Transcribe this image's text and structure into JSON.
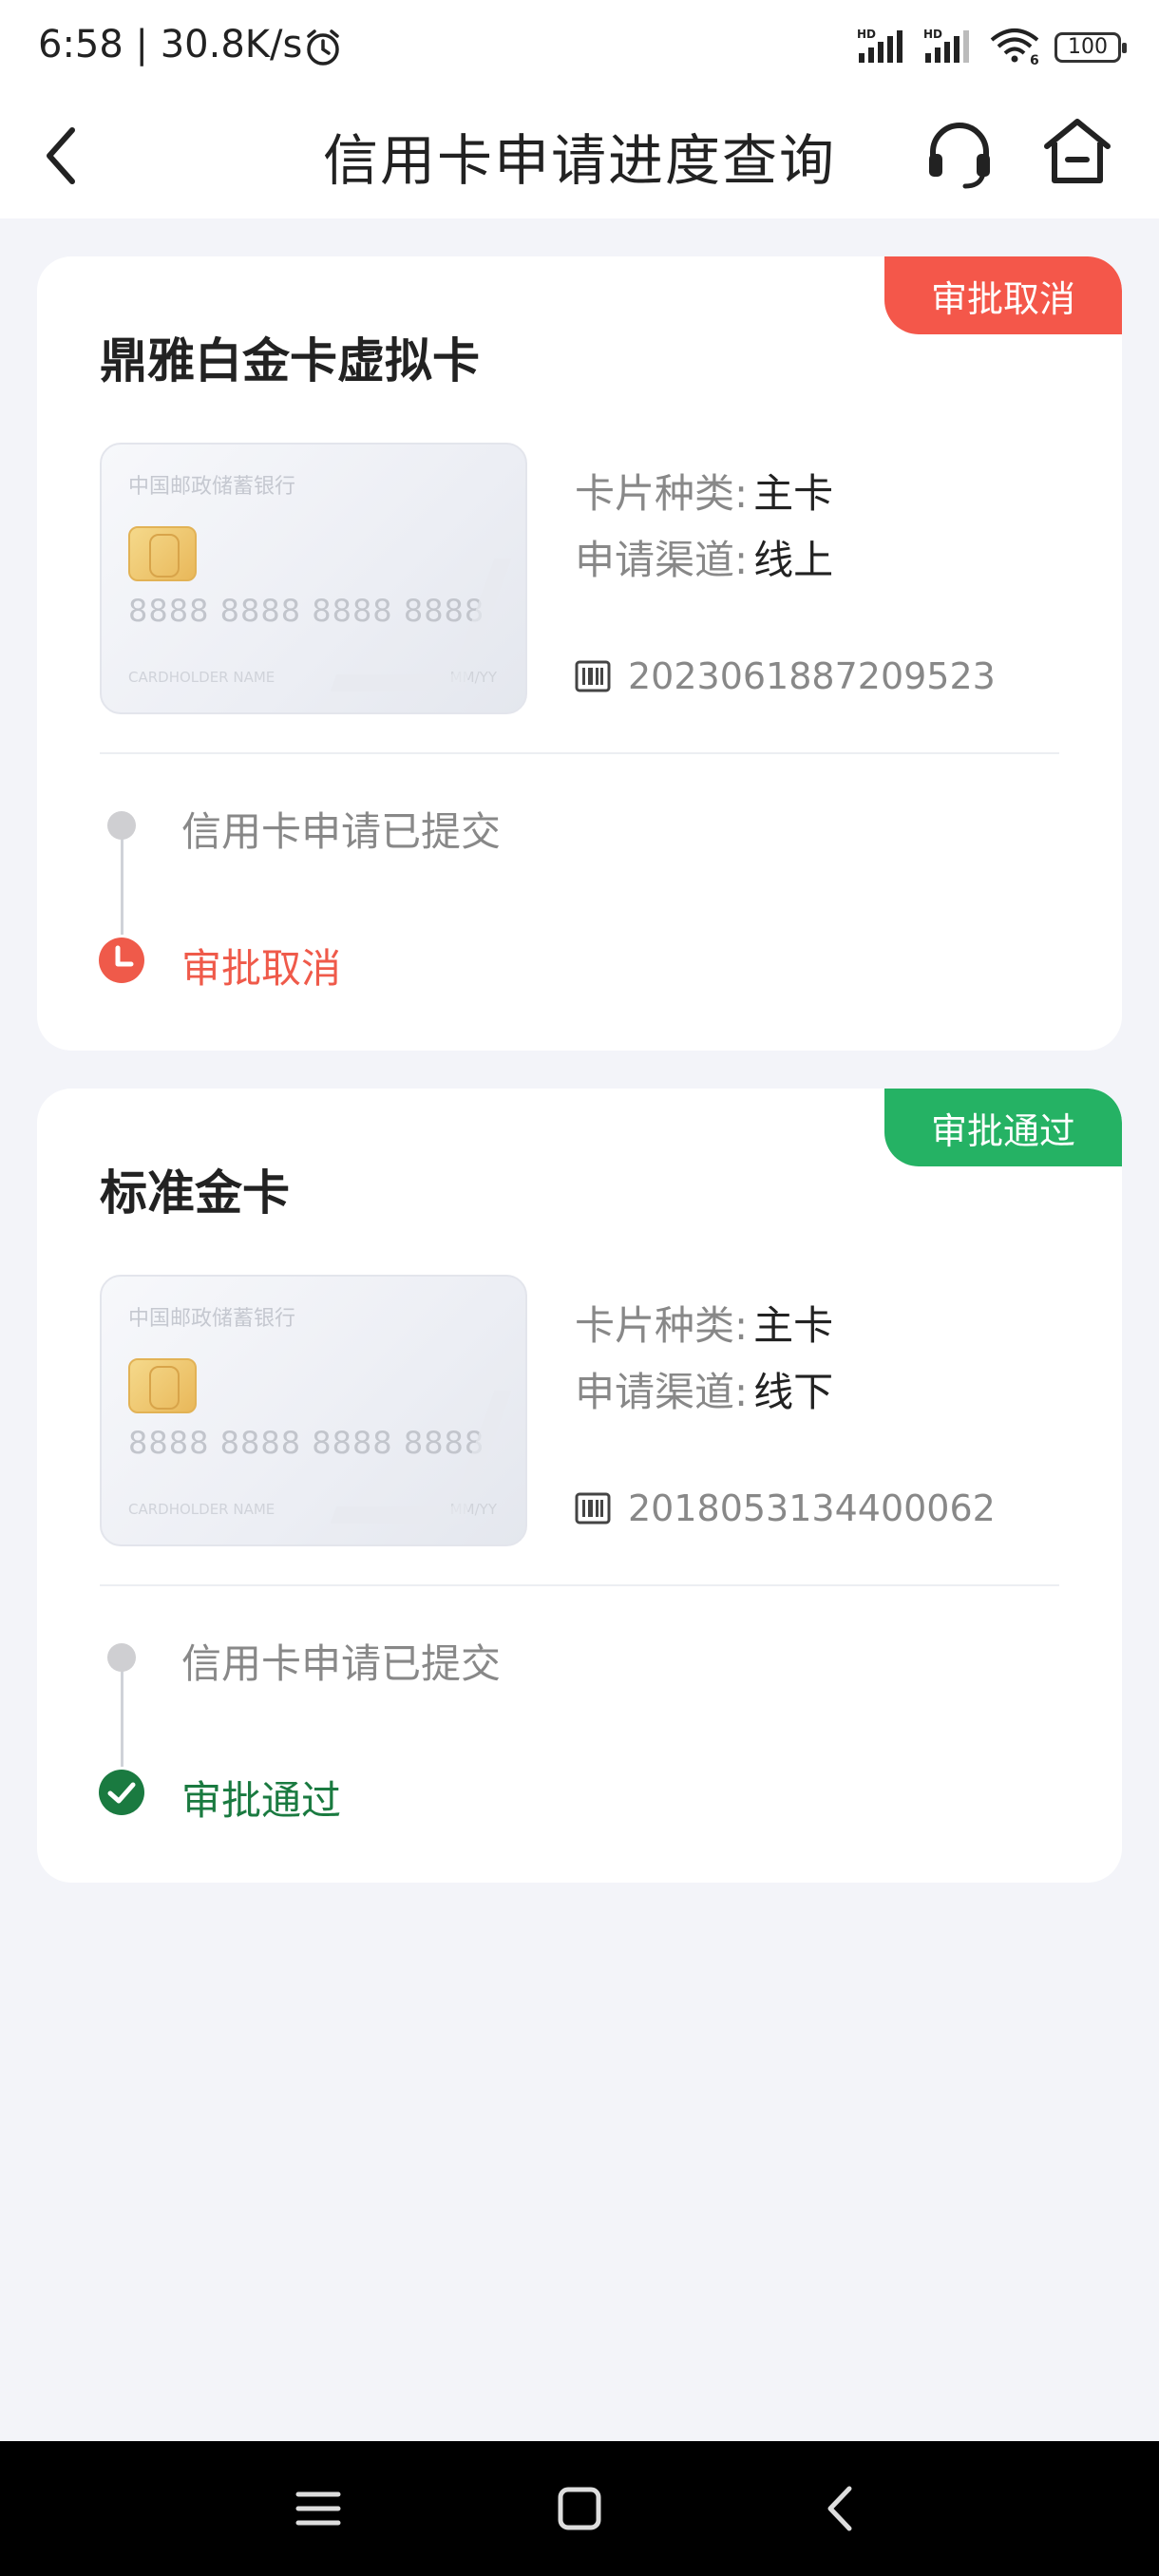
{
  "status_bar": {
    "time": "6:58 | 30.8K/s",
    "battery": "100"
  },
  "header": {
    "title": "信用卡申请进度查询"
  },
  "applications": [
    {
      "card_name": "鼎雅白金卡虚拟卡",
      "status_tag": "审批取消",
      "card_kind_label": "卡片种类:",
      "card_kind_value": "主卡",
      "channel_label": "申请渠道:",
      "channel_value": "线上",
      "app_number": "2023061887209523",
      "step1": "信用卡申请已提交",
      "step2": "审批取消",
      "step2_color": "#ef5a4a"
    },
    {
      "card_name": "标准金卡",
      "status_tag": "审批通过",
      "card_kind_label": "卡片种类:",
      "card_kind_value": "主卡",
      "channel_label": "申请渠道:",
      "channel_value": "线下",
      "app_number": "2018053134400062",
      "step1": "信用卡申请已提交",
      "step2": "审批通过",
      "step2_color": "#1a7a40"
    }
  ],
  "card_image": {
    "bank": "中国邮政储蓄银行",
    "number": "8888 8888 8888 8888",
    "holder": "CARDHOLDER NAME",
    "expiry": "MM/YY"
  },
  "colors": {
    "cancel_tag": "#f4574a",
    "approve_tag": "#25b264",
    "page_bg": "#f3f4f9"
  },
  "icons": {
    "back": "chevron-left-icon",
    "support": "headset-icon",
    "home": "home-icon",
    "barcode": "barcode-icon",
    "cancel_step": "clock-icon",
    "approve_step": "check-circle-icon"
  }
}
